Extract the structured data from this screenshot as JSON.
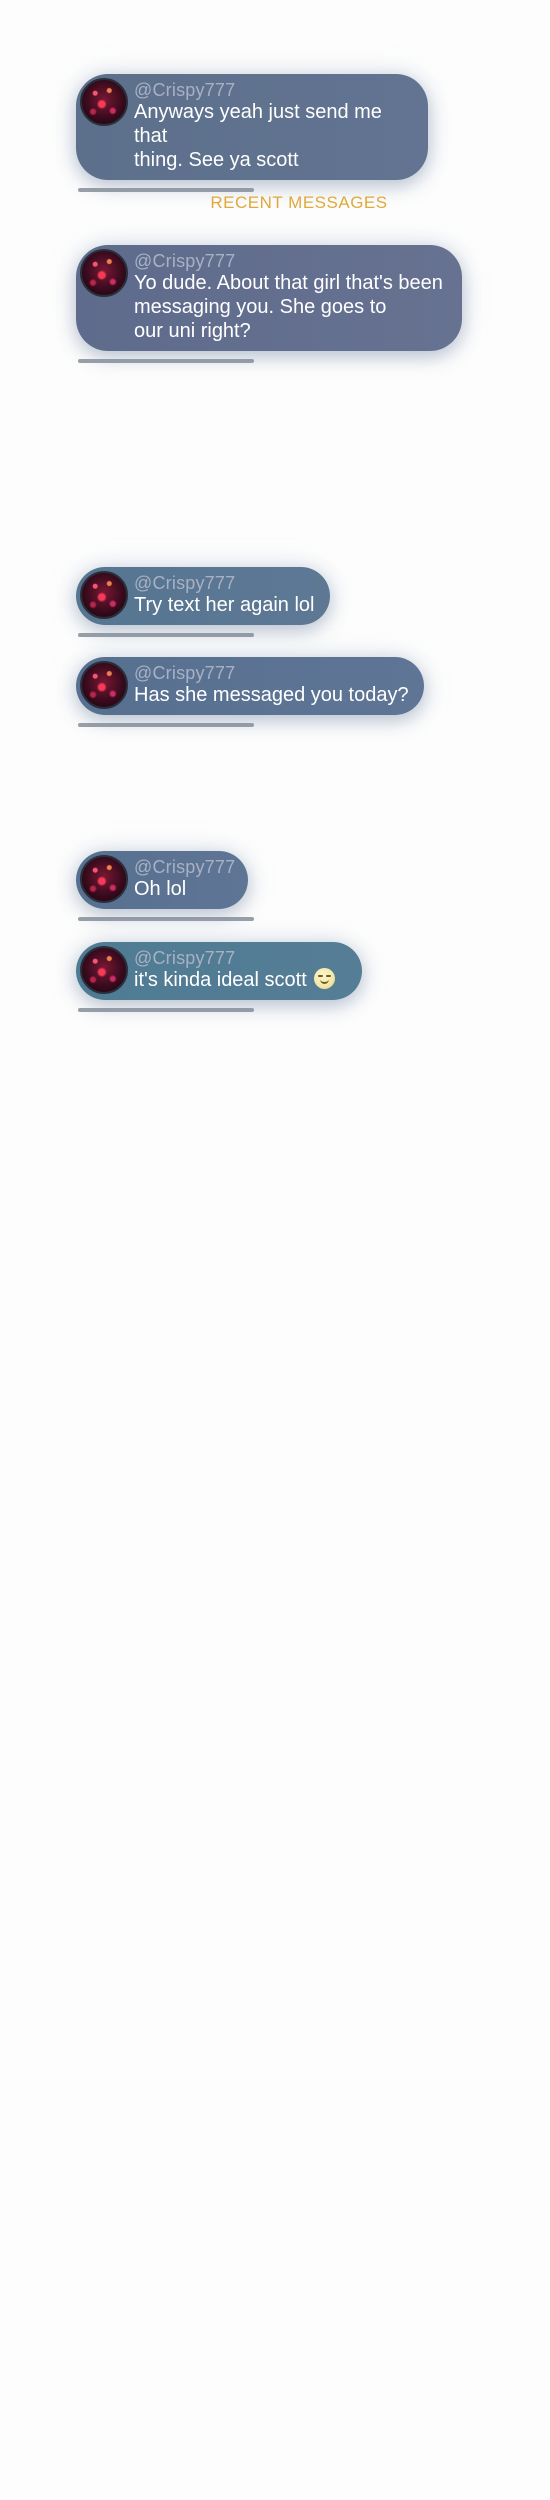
{
  "section": {
    "title": "RECENT MESSAGES"
  },
  "messages": [
    {
      "handle": "@Crispy777",
      "lines": [
        "Anyways yeah just send me that",
        "thing. See ya scott"
      ]
    },
    {
      "handle": "@Crispy777",
      "lines": [
        "Yo dude. About that girl that's been",
        "messaging you. She goes to",
        "our uni right?"
      ]
    },
    {
      "handle": "@Crispy777",
      "lines": [
        "Try text her again lol"
      ]
    },
    {
      "handle": "@Crispy777",
      "lines": [
        "Has she messaged you today?"
      ]
    },
    {
      "handle": "@Crispy777",
      "lines": [
        "Oh lol"
      ]
    },
    {
      "handle": "@Crispy777",
      "lines": [
        "it's kinda ideal scott"
      ],
      "emoji": "slightly-smiling-face-icon"
    }
  ]
}
